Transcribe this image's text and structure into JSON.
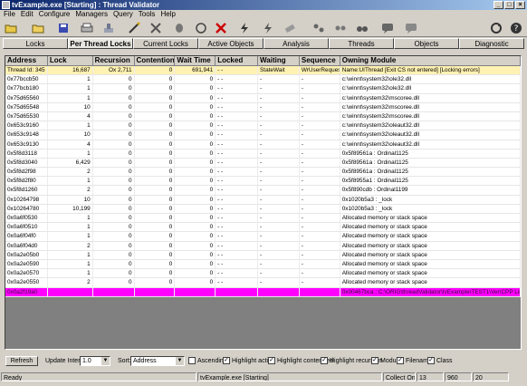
{
  "window": {
    "title": "tvExample.exe [Starting] : Thread Validator"
  },
  "menu": [
    "File",
    "Edit",
    "Configure",
    "Managers",
    "Query",
    "Tools",
    "Help"
  ],
  "toolbar_icons": [
    "open-icon",
    "folder-icon",
    "save-icon",
    "print-icon",
    "close-icon",
    "wand-icon",
    "tools-icon",
    "refresh-icon",
    "stop-icon",
    "lightning-icon",
    "bolt-icon",
    "erase-icon",
    "shuffle-icon",
    "dna-icon",
    "binoculars-icon",
    "chat-icon",
    "comment-icon",
    "refresh-circle-icon",
    "help-icon"
  ],
  "tabs": [
    "Locks",
    "Per Thread Locks",
    "Current Locks",
    "Active Objects",
    "Analysis",
    "Threads",
    "Objects",
    "Diagnostic"
  ],
  "active_tab": "Per Thread Locks",
  "grid": {
    "columns": [
      "Address",
      "Lock",
      "Recursion",
      "Contention",
      "Wait Time",
      "Locked",
      "Waiting",
      "Sequence",
      "Owning Module"
    ],
    "rows": [
      [
        "Thread Id: 345",
        "16,687",
        "Ox 2,711",
        "0",
        "691,941",
        "- -",
        "StateWait",
        "WrUserRequest",
        "Name:UIThread [Exit CS not entered] [Locking errors]"
      ],
      [
        "0x77bccb50",
        "1",
        "0",
        "0",
        "0",
        "- -",
        "-",
        "-",
        "c:\\winnt\\system32\\ole32.dll"
      ],
      [
        "0x77bcb180",
        "1",
        "0",
        "0",
        "0",
        "- -",
        "-",
        "-",
        "c:\\winnt\\system32\\ole32.dll"
      ],
      [
        "0x75d65560",
        "1",
        "0",
        "0",
        "0",
        "- -",
        "-",
        "-",
        "c:\\winnt\\system32\\mscoree.dll"
      ],
      [
        "0x75d65548",
        "10",
        "0",
        "0",
        "0",
        "- -",
        "-",
        "-",
        "c:\\winnt\\system32\\mscoree.dll"
      ],
      [
        "0x75d65530",
        "4",
        "0",
        "0",
        "0",
        "- -",
        "-",
        "-",
        "c:\\winnt\\system32\\mscoree.dll"
      ],
      [
        "0x653c9160",
        "1",
        "0",
        "0",
        "0",
        "- -",
        "-",
        "-",
        "c:\\winnt\\system32\\oleaut32.dll"
      ],
      [
        "0x653c9148",
        "10",
        "0",
        "0",
        "0",
        "- -",
        "-",
        "-",
        "c:\\winnt\\system32\\oleaut32.dll"
      ],
      [
        "0x653c9130",
        "4",
        "0",
        "0",
        "0",
        "- -",
        "-",
        "-",
        "c:\\winnt\\system32\\oleaut32.dll"
      ],
      [
        "0x5f8d3118",
        "1",
        "0",
        "0",
        "0",
        "- -",
        "-",
        "-",
        "0x5f89561a : Ordinal1125"
      ],
      [
        "0x5f8d3040",
        "6,429",
        "0",
        "0",
        "0",
        "- -",
        "-",
        "-",
        "0x5f89561a : Ordinal1125"
      ],
      [
        "0x5f8d2f98",
        "2",
        "0",
        "0",
        "0",
        "- -",
        "-",
        "-",
        "0x5f89561a : Ordinal1125"
      ],
      [
        "0x5f8d2f80",
        "1",
        "0",
        "0",
        "0",
        "- -",
        "-",
        "-",
        "0x5f8955a1 : Ordinal1125"
      ],
      [
        "0x5f8d1260",
        "2",
        "0",
        "0",
        "0",
        "- -",
        "-",
        "-",
        "0x5f890cdb : Ordinal1199"
      ],
      [
        "0x10264798",
        "10",
        "0",
        "0",
        "0",
        "- -",
        "-",
        "-",
        "0x1020b5a3 : _lock"
      ],
      [
        "0x10264780",
        "10,199",
        "0",
        "0",
        "0",
        "- -",
        "-",
        "-",
        "0x1020b5a3 : _lock"
      ],
      [
        "0x0a6f0530",
        "1",
        "0",
        "0",
        "0",
        "- -",
        "-",
        "-",
        "Allocated memory or stack space"
      ],
      [
        "0x0a6f0510",
        "1",
        "0",
        "0",
        "0",
        "- -",
        "-",
        "-",
        "Allocated memory or stack space"
      ],
      [
        "0x0a6f04f0",
        "1",
        "0",
        "0",
        "0",
        "- -",
        "-",
        "-",
        "Allocated memory or stack space"
      ],
      [
        "0x0a6f04d0",
        "2",
        "0",
        "0",
        "0",
        "- -",
        "-",
        "-",
        "Allocated memory or stack space"
      ],
      [
        "0x0a2e05b0",
        "1",
        "0",
        "0",
        "0",
        "- -",
        "-",
        "-",
        "Allocated memory or stack space"
      ],
      [
        "0x0a2e0590",
        "1",
        "0",
        "0",
        "0",
        "- -",
        "-",
        "-",
        "Allocated memory or stack space"
      ],
      [
        "0x0a2e0570",
        "1",
        "0",
        "0",
        "0",
        "- -",
        "-",
        "-",
        "Allocated memory or stack space"
      ],
      [
        "0x0a2e0550",
        "2",
        "0",
        "0",
        "0",
        "- -",
        "-",
        "-",
        "Allocated memory or stack space"
      ],
      [
        "0x0a2f19a0",
        "",
        "",
        "",
        "",
        "",
        "",
        "",
        "0x00467bca : C:\\ORIG\\threadValidator\\tvExample\\TEST1\\Ver\\CPP Line 7597"
      ]
    ],
    "selected_row": 0,
    "highlighted_row": 24
  },
  "controls": {
    "refresh_label": "Refresh",
    "update_interval_label": "Update Interval:",
    "update_interval_value": "1.0",
    "sort_label": "Sort:",
    "sort_value": "Address",
    "checkboxes": [
      {
        "label": "Ascending",
        "checked": false
      },
      {
        "label": "Highlight active",
        "checked": true
      },
      {
        "label": "Highlight contended",
        "checked": true
      },
      {
        "label": "Highlight recursion",
        "checked": true
      },
      {
        "label": "Module",
        "checked": true
      },
      {
        "label": "Filename",
        "checked": true
      },
      {
        "label": "Class",
        "checked": true
      }
    ]
  },
  "status": {
    "left": "Ready",
    "center": "tvExample.exe [Starting]",
    "state": "Collect On",
    "n1": "13",
    "n2": "960",
    "n3": "20"
  },
  "colors": {
    "selected_row": "#fff2b3",
    "highlighted_row": "#ff00ff",
    "title_start": "#0a246a"
  }
}
